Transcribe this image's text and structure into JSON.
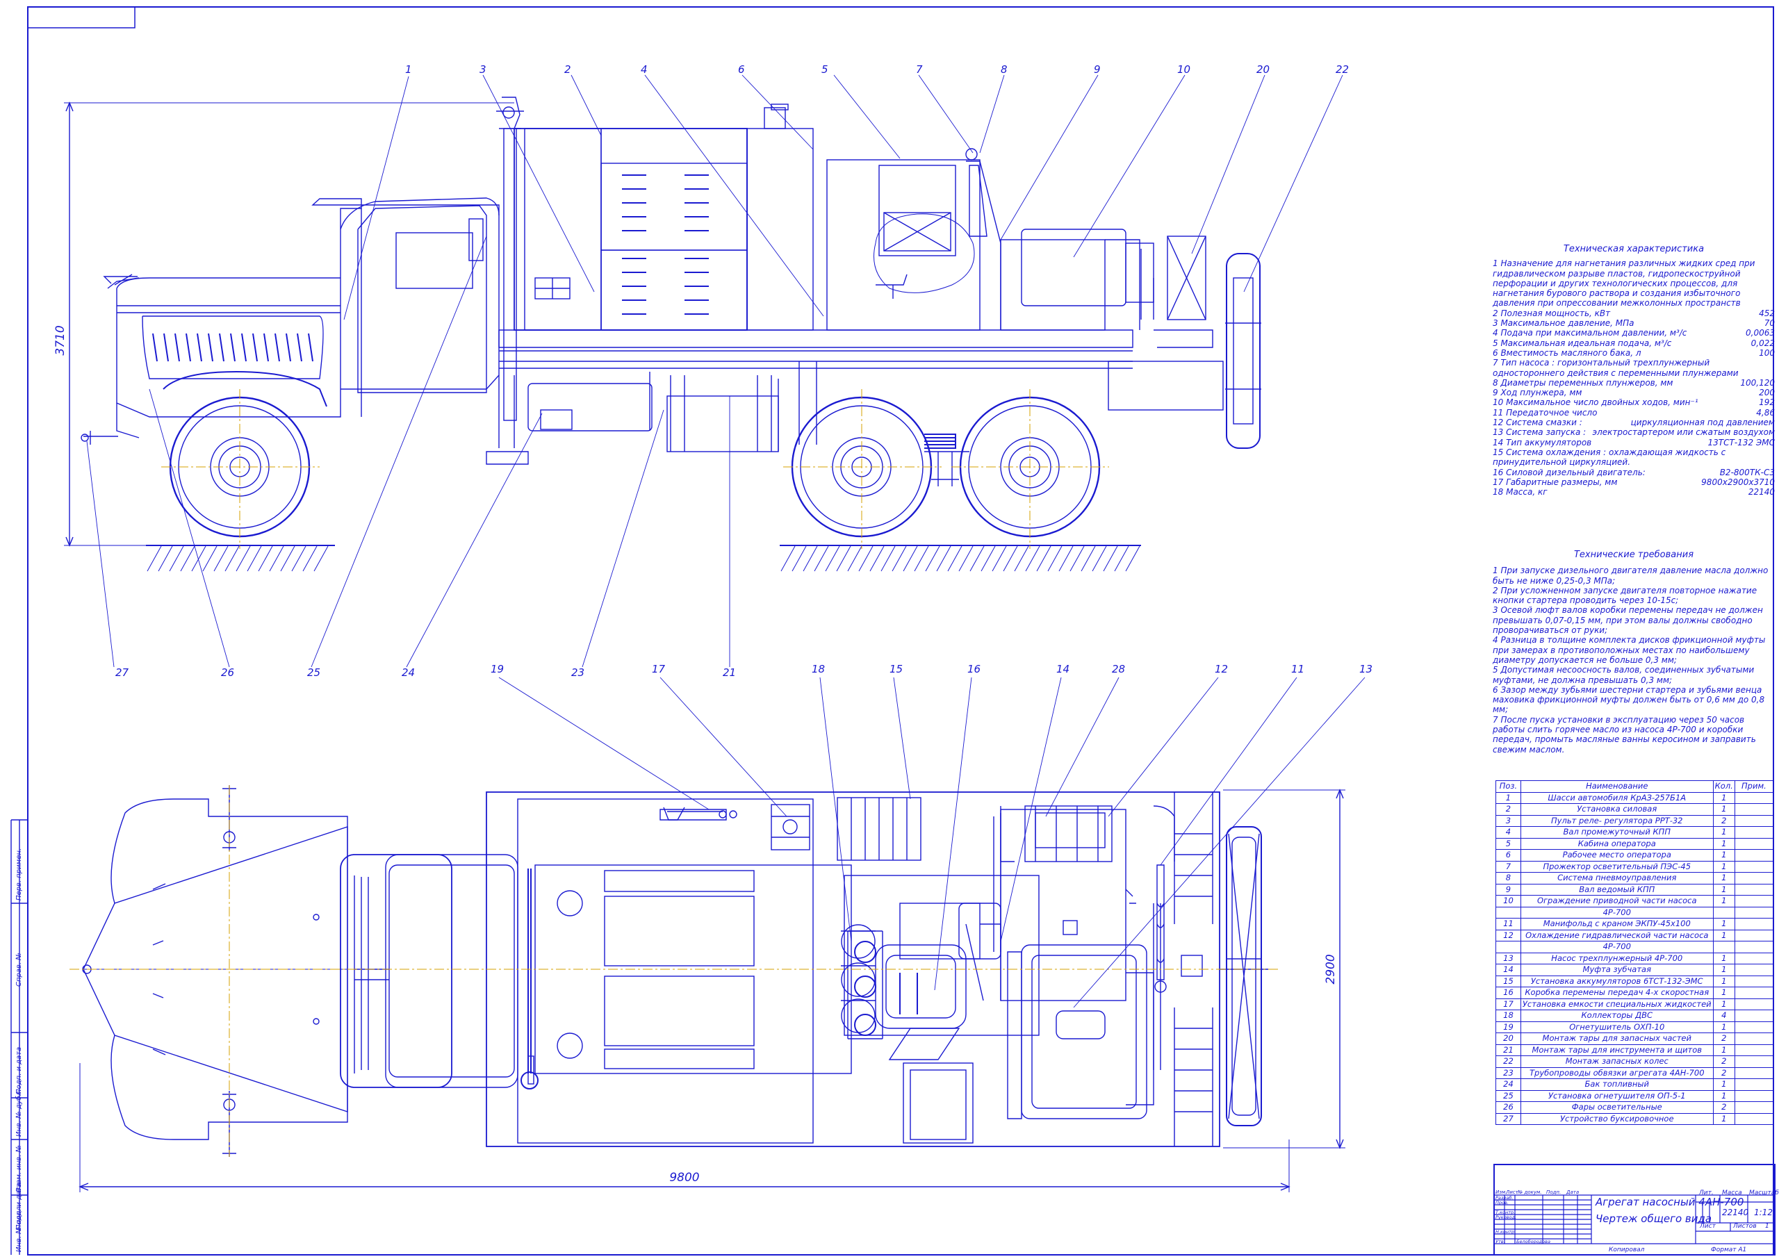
{
  "drawing": {
    "overall_height_label": "3710",
    "overall_length_label": "9800",
    "overall_width_label": "2900",
    "side_callouts_top": [
      "1",
      "3",
      "2",
      "4",
      "6",
      "5",
      "7",
      "8",
      "9",
      "10",
      "20",
      "22"
    ],
    "side_callouts_bottom": [
      "27",
      "26",
      "25",
      "24",
      "23",
      "21"
    ],
    "plan_callouts": [
      "19",
      "17",
      "18",
      "15",
      "16",
      "14",
      "28",
      "12",
      "11",
      "13"
    ]
  },
  "specs": {
    "title": "Техническая характеристика",
    "intro": "1 Назначение для нагнетания различных жидких сред при гидравлическом разрыве пластов, гидропескоструйной перфорации и других технологических процессов, для нагнетания бурового раствора и создания избыточного давления при опрессовании межколонных пространств",
    "rows": [
      {
        "label": "2 Полезная мощность, кВт",
        "value": "452"
      },
      {
        "label": "3 Максимальное давление, МПа",
        "value": "70"
      },
      {
        "label": "4 Подача при максимальном давлении, м³/с",
        "value": "0,0063"
      },
      {
        "label": "5 Максимальная идеальная подача, м³/с",
        "value": "0,022"
      },
      {
        "label": "6 Вместимость масляного бака, л",
        "value": "100"
      }
    ],
    "item7": "7 Тип насоса : горизонтальный трехплунжерный одностороннего действия с переменными плунжерами",
    "rows2": [
      {
        "label": "8 Диаметры переменных плунжеров, мм",
        "value": "100,120"
      },
      {
        "label": "9 Ход плунжера, мм",
        "value": "200"
      },
      {
        "label": "10 Максимальное число двойных ходов, мин⁻¹",
        "value": "192"
      },
      {
        "label": "11 Передаточное число",
        "value": "4,86"
      },
      {
        "label": "12 Система смазки :",
        "value": "циркуляционная под давлением"
      },
      {
        "label": "13 Система запуска :",
        "value": "электростартером или сжатым воздухом"
      },
      {
        "label": "14 Тип аккумуляторов",
        "value": "13ТСТ-132 ЭМС"
      }
    ],
    "item15": "15 Система охлаждения : охлаждающая жидкость с принудительной циркуляцией.",
    "rows3": [
      {
        "label": "16 Силовой дизельный двигатель:",
        "value": "В2-800ТК-С3"
      },
      {
        "label": "17 Габаритные размеры, мм",
        "value": "9800х2900х3710"
      },
      {
        "label": "18 Масса, кг",
        "value": "22140"
      }
    ]
  },
  "requirements": {
    "title": "Технические требования",
    "items": [
      "1 При запуске дизельного двигателя давление масла должно быть не ниже 0,25-0,3 МПа;",
      "2 При усложненном запуске двигателя повторное нажатие кнопки стартера проводить через 10-15с;",
      "3 Осевой люфт валов коробки перемены передач не должен превышать 0,07-0,15 мм, при этом валы должны свободно проворачиваться от руки;",
      "4 Разница в толщине комплекта дисков фрикционной муфты при замерах в противоположных местах по наибольшему диаметру допускается не больше 0,3 мм;",
      "5 Допустимая несоосность валов, соединенных зубчатыми муфтами, не должна превышать 0,3 мм;",
      "6 Зазор между зубьями шестерни стартера и зубьями венца маховика фрикционной муфты должен быть от 0,6 мм до 0,8 мм;",
      "7 После пуска установки в эксплуатацию через 50 часов работы слить горячее масло из насоса 4Р-700 и коробки передач, промыть масляные ванны керосином и заправить свежим маслом."
    ]
  },
  "bom": {
    "headers": [
      "Поз.",
      "Наименование",
      "Кол.",
      "Прим."
    ],
    "rows": [
      [
        "1",
        "Шасси автомобиля КрАЗ-257Б1А",
        "1",
        ""
      ],
      [
        "2",
        "Установка силовая",
        "1",
        ""
      ],
      [
        "3",
        "Пульт реле- регулятора РРТ-32",
        "2",
        ""
      ],
      [
        "4",
        "Вал промежуточный КПП",
        "1",
        ""
      ],
      [
        "5",
        "Кабина оператора",
        "1",
        ""
      ],
      [
        "6",
        "Рабочее место оператора",
        "1",
        ""
      ],
      [
        "7",
        "Прожектор осветительный ПЭС-45",
        "1",
        ""
      ],
      [
        "8",
        "Система пневмоуправления",
        "1",
        ""
      ],
      [
        "9",
        "Вал ведомый КПП",
        "1",
        ""
      ],
      [
        "10",
        "Ограждение приводной части насоса",
        "1",
        ""
      ],
      [
        "",
        "4Р-700",
        "",
        ""
      ],
      [
        "11",
        "Манифольд с краном ЭКПУ-45х100",
        "1",
        ""
      ],
      [
        "12",
        "Охлаждение гидравлической части насоса",
        "1",
        ""
      ],
      [
        "",
        "4Р-700",
        "",
        ""
      ],
      [
        "13",
        "Насос трехплунжерный 4Р-700",
        "1",
        ""
      ],
      [
        "14",
        "Муфта зубчатая",
        "1",
        ""
      ],
      [
        "15",
        "Установка аккумуляторов 6ТСТ-132-ЭМС",
        "1",
        ""
      ],
      [
        "16",
        "Коробка перемены передач 4-х скоростная",
        "1",
        ""
      ],
      [
        "17",
        "Установка емкости специальных жидкостей",
        "1",
        ""
      ],
      [
        "18",
        "Коллекторы ДВС",
        "4",
        ""
      ],
      [
        "19",
        "Огнетушитель ОХП-10",
        "1",
        ""
      ],
      [
        "20",
        "Монтаж тары для запасных частей",
        "2",
        ""
      ],
      [
        "21",
        "Монтаж тары для инструмента и щитов",
        "1",
        ""
      ],
      [
        "22",
        "Монтаж запасных колес",
        "2",
        ""
      ],
      [
        "23",
        "Трубопроводы обвязки агрегата 4АН-700",
        "2",
        ""
      ],
      [
        "24",
        "Бак топливный",
        "1",
        ""
      ],
      [
        "25",
        "Установка огнетушителя ОП-5-1",
        "1",
        ""
      ],
      [
        "26",
        "Фары осветительные",
        "2",
        ""
      ],
      [
        "27",
        "Устройство буксировочное",
        "1",
        ""
      ]
    ]
  },
  "title_block": {
    "title_line1": "Агрегат насосный 4АН-700",
    "title_line2": "Чертеж общего вида",
    "mass_header": "Масса",
    "scale_header": "Масштаб",
    "lit_header": "Лит.",
    "mass": "22140",
    "scale": "1:12",
    "sheet_label": "Лист",
    "sheets_label": "Листов",
    "sheets_value": "1",
    "roles": [
      "Изм.",
      "Лист",
      "№ докум.",
      "Подп.",
      "Дата",
      "Разраб.",
      "Пров.",
      "Т.контр.",
      "Руковод.",
      "Н.контр.",
      "Утв."
    ],
    "approver": "Белобородова",
    "copied": "Копировал",
    "format": "Формат   А1"
  },
  "side_stamps": [
    "Перв. примен.",
    "Справ. №",
    "Подп. и дата",
    "Инв. № дубл.",
    "Взам. инв. №",
    "Подп. и дата",
    "Инв. № подл."
  ]
}
